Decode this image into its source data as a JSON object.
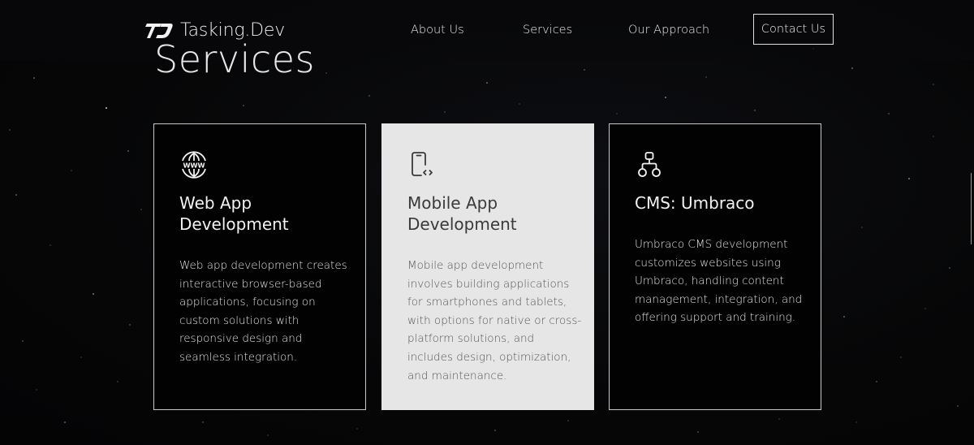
{
  "brand": {
    "name": "Tasking.Dev",
    "logo_icon": "td-monogram-icon"
  },
  "nav": {
    "about": "About Us",
    "services": "Services",
    "approach": "Our Approach",
    "contact": "Contact Us"
  },
  "section": {
    "title": "Services"
  },
  "cards": [
    {
      "icon": "www-globe-icon",
      "title": "Web App Development",
      "description": "Web app development creates interactive browser-based applications, focusing on custom solutions with responsive design and seamless integration."
    },
    {
      "icon": "mobile-code-icon",
      "title": "Mobile App Development",
      "description": "Mobile app development involves building applications for smartphones and tablets, with options for native or cross-platform solutions, and includes design, optimization, and maintenance."
    },
    {
      "icon": "sitemap-icon",
      "title": "CMS: Umbraco",
      "description": "Umbraco CMS development customizes websites using Umbraco, handling content management, integration, and offering support and training."
    }
  ],
  "colors": {
    "background": "#060607",
    "card_dark": "#020203",
    "card_light": "#e6e6e6",
    "text_light": "#f0f0f0",
    "text_dark": "#3a3a3a"
  }
}
